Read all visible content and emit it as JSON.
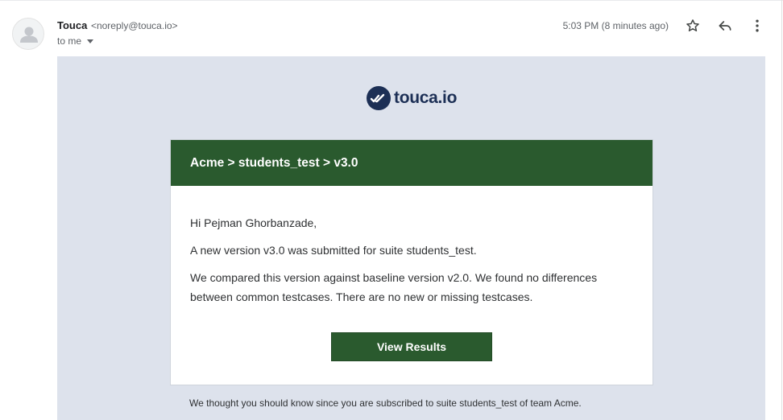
{
  "header": {
    "sender_name": "Touca",
    "sender_email": "<noreply@touca.io>",
    "recipient": "to me",
    "timestamp": "5:03 PM (8 minutes ago)",
    "icons": {
      "avatar": "person-icon",
      "star": "star-icon",
      "reply": "reply-icon",
      "more": "more-vert-icon",
      "recipient_dropdown": "chevron-down-icon"
    }
  },
  "email": {
    "logo_text": "touca.io",
    "card_title": "Acme > students_test > v3.0",
    "greeting": "Hi Pejman Ghorbanzade,",
    "paragraph1": "A new version v3.0 was submitted for suite students_test.",
    "paragraph2": "We compared this version against baseline version v2.0. We found no differences between common testcases. There are no new or missing testcases.",
    "button_label": "View Results",
    "footer_note": "We thought you should know since you are subscribed to suite students_test of team Acme."
  },
  "colors": {
    "brand_green": "#2a5a2e",
    "brand_navy": "#1c2f55",
    "email_background": "#dde2ec"
  }
}
